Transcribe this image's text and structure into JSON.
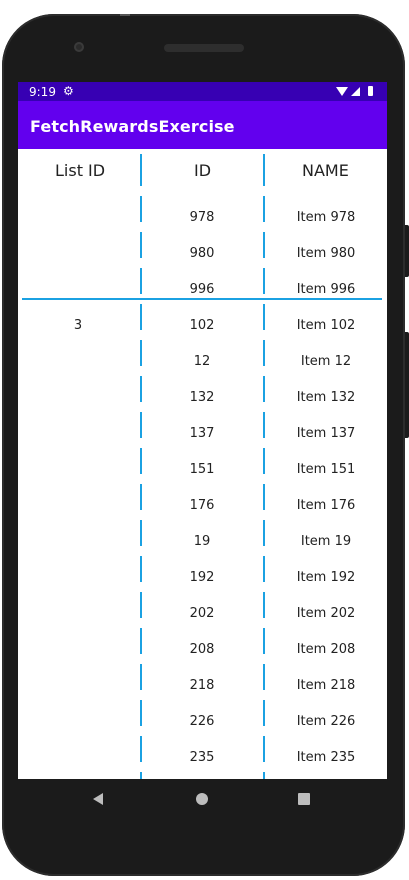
{
  "status_bar": {
    "time": "9:19",
    "icons": [
      "gear-icon",
      "wifi-icon",
      "signal-icon",
      "battery-icon"
    ]
  },
  "app_bar": {
    "title": "FetchRewardsExercise"
  },
  "table": {
    "headers": {
      "list_id": "List ID",
      "id": "ID",
      "name": "NAME"
    },
    "rows": [
      {
        "list_id": "",
        "id": "978",
        "name": "Item 978"
      },
      {
        "list_id": "",
        "id": "980",
        "name": "Item 980"
      },
      {
        "list_id": "",
        "id": "996",
        "name": "Item 996"
      },
      {
        "list_id": "3",
        "id": "102",
        "name": "Item 102"
      },
      {
        "list_id": "",
        "id": "12",
        "name": "Item 12"
      },
      {
        "list_id": "",
        "id": "132",
        "name": "Item 132"
      },
      {
        "list_id": "",
        "id": "137",
        "name": "Item 137"
      },
      {
        "list_id": "",
        "id": "151",
        "name": "Item 151"
      },
      {
        "list_id": "",
        "id": "176",
        "name": "Item 176"
      },
      {
        "list_id": "",
        "id": "19",
        "name": "Item 19"
      },
      {
        "list_id": "",
        "id": "192",
        "name": "Item 192"
      },
      {
        "list_id": "",
        "id": "202",
        "name": "Item 202"
      },
      {
        "list_id": "",
        "id": "208",
        "name": "Item 208"
      },
      {
        "list_id": "",
        "id": "218",
        "name": "Item 218"
      },
      {
        "list_id": "",
        "id": "226",
        "name": "Item 226"
      },
      {
        "list_id": "",
        "id": "235",
        "name": "Item 235"
      }
    ]
  },
  "nav_bar": {
    "buttons": [
      "back-icon",
      "home-icon",
      "recents-icon"
    ]
  },
  "colors": {
    "status_bar": "#3700b3",
    "app_bar": "#6200ee",
    "divider": "#1ba1e2"
  }
}
